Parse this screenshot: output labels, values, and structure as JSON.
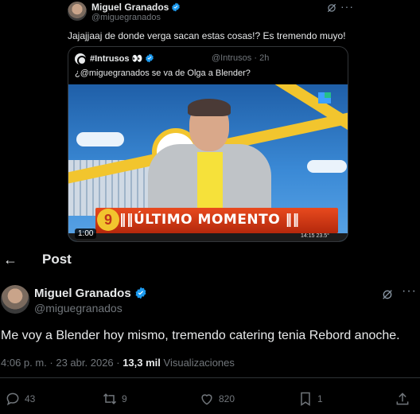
{
  "quoted_context": {
    "author_name": "Miguel Granados",
    "author_handle": "@miguegranados",
    "text": "Jajajjaaj de donde verga sacan estas cosas!? Es tremendo muyo!",
    "quote": {
      "name": "#Intrusos 👀",
      "handle_time": "@Intrusos · 2h",
      "text": "¿@miguegranados se va de Olga a Blender?",
      "video": {
        "banner": "ÚLTIMO MOMENTO",
        "badge_num": "9",
        "duration": "1:00",
        "clock": "14:15   23.5°"
      }
    }
  },
  "header": {
    "back_icon": "back-arrow-icon",
    "title": "Post"
  },
  "post": {
    "author_name": "Miguel Granados",
    "author_handle": "@miguegranados",
    "text": "Me voy a Blender hoy mismo, tremendo catering tenia Rebord anoche.",
    "timestamp": "4:06 p. m. · 23 abr. 2026 · ",
    "views_count": "13,3 mil",
    "views_label": " Visualizaciones"
  },
  "actions": {
    "replies": "43",
    "reposts": "9",
    "likes": "820",
    "bookmarks": "1"
  },
  "colors": {
    "verified": "#1d9bf0",
    "background": "#000000",
    "muted": "#71767b"
  }
}
